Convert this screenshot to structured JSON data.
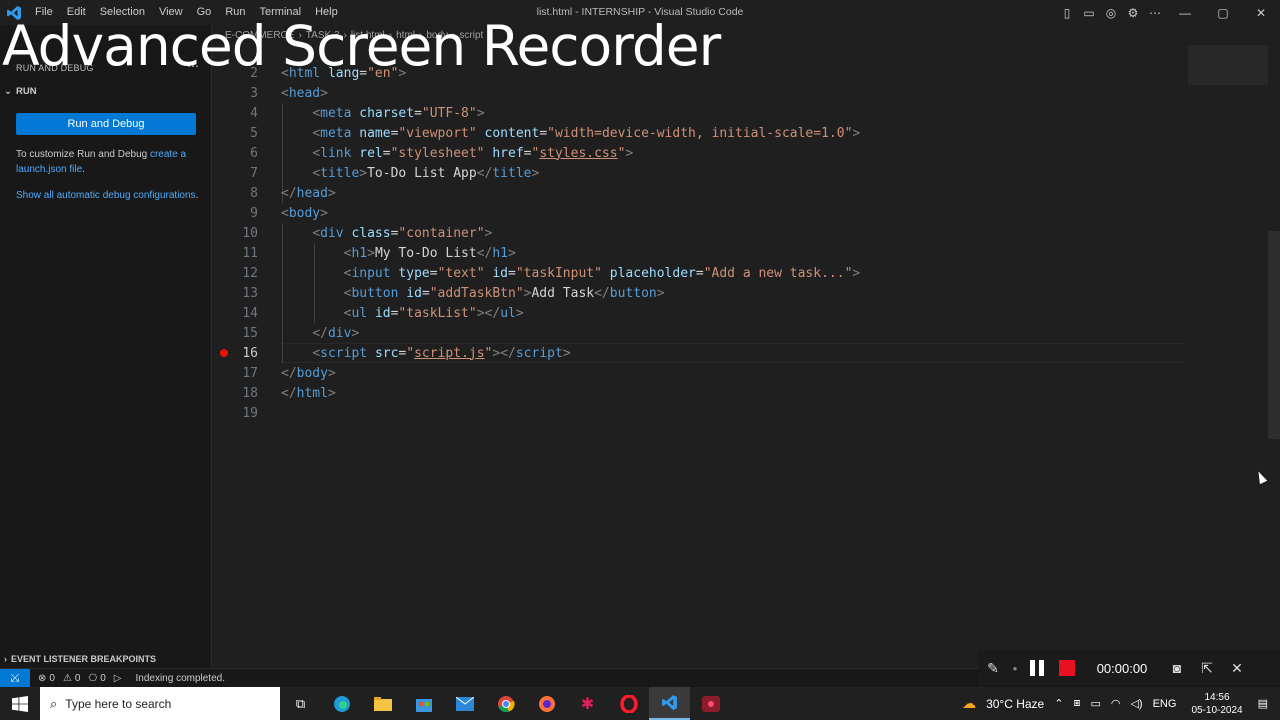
{
  "titlebar": {
    "menu": [
      "File",
      "Edit",
      "Selection",
      "View",
      "Go",
      "Run",
      "Terminal",
      "Help"
    ],
    "window_title": "list.html - INTERNSHIP - Visual Studio Code"
  },
  "watermark": "Advanced Screen Recorder",
  "sidebar": {
    "header": "RUN AND DEBUG",
    "section_run": "RUN",
    "run_button": "Run and Debug",
    "customize_text": "To customize Run and Debug ",
    "customize_link": "create a launch.json file",
    "customize_tail": ".",
    "show_all_link": "Show all automatic debug configurations",
    "show_all_tail": ".",
    "footer_section": "EVENT LISTENER BREAKPOINTS"
  },
  "breadcrumb": [
    "E-COMMERCE",
    "TASK 3",
    "list.html",
    "html",
    "body",
    "script"
  ],
  "editor": {
    "active_line": 16,
    "breakpoint_line": 16,
    "line_numbers": [
      "2",
      "3",
      "4",
      "5",
      "6",
      "7",
      "8",
      "9",
      "10",
      "11",
      "12",
      "13",
      "14",
      "15",
      "16",
      "17",
      "18",
      "19"
    ]
  },
  "statusbar": {
    "errors": "0",
    "warnings": "0",
    "ports": "0",
    "message": "Indexing completed."
  },
  "recorder": {
    "timer": "00:00:00"
  },
  "taskbar": {
    "search_placeholder": "Type here to search",
    "weather": "30°C  Haze",
    "language": "ENG",
    "time": "14:56",
    "date": "05-10-2024"
  },
  "colors": {
    "accent": "#0078d4",
    "breakpoint": "#e51400",
    "record_stop": "#e81123"
  }
}
